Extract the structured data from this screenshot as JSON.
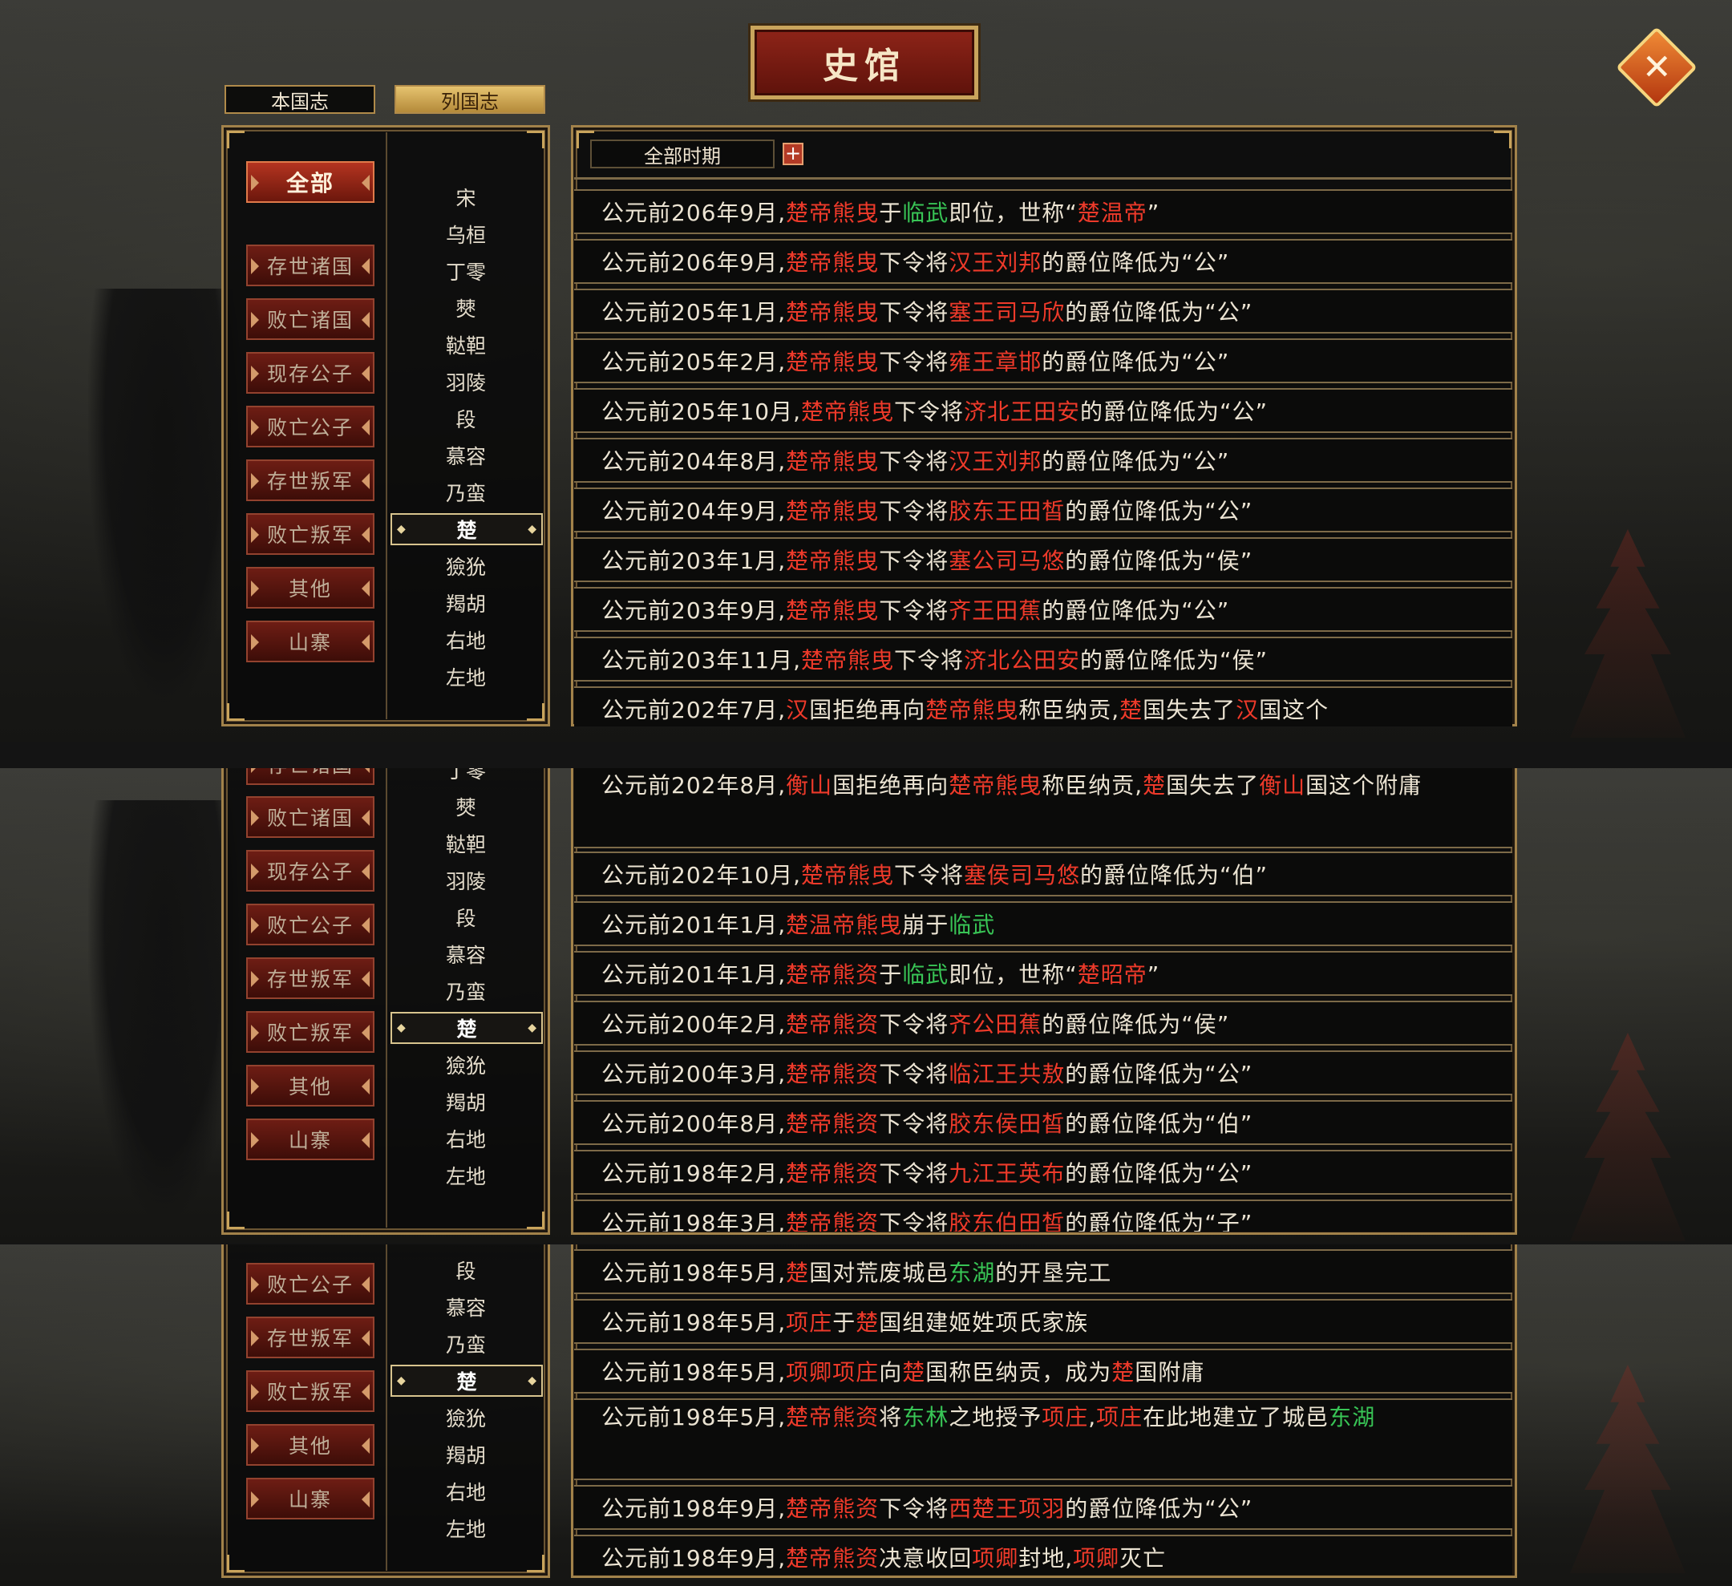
{
  "title": "史馆",
  "close_label": "✕",
  "tabs": [
    "本国志",
    "列国志"
  ],
  "period_select": "全部时期",
  "plus_label": "+",
  "categories": [
    "全部",
    "存世诸国",
    "败亡诸国",
    "现存公子",
    "败亡公子",
    "存世叛军",
    "败亡叛军",
    "其他",
    "山寨"
  ],
  "nations": [
    "宋",
    "乌桓",
    "丁零",
    "僰",
    "鞑靼",
    "羽陵",
    "段",
    "慕容",
    "乃蛮",
    "楚",
    "獫狁",
    "羯胡",
    "右地",
    "左地"
  ],
  "selected_nation": "楚",
  "events": [
    [
      [
        "公元前206年9月,",
        ""
      ],
      [
        "楚帝熊曳",
        "r"
      ],
      [
        "于",
        ""
      ],
      [
        "临武",
        "g"
      ],
      [
        "即位，世称“",
        ""
      ],
      [
        "楚温帝",
        "r"
      ],
      [
        "”",
        ""
      ]
    ],
    [
      [
        "公元前206年9月,",
        ""
      ],
      [
        "楚帝熊曳",
        "r"
      ],
      [
        "下令将",
        ""
      ],
      [
        "汉王刘邦",
        "r"
      ],
      [
        "的爵位降低为“公”",
        ""
      ]
    ],
    [
      [
        "公元前205年1月,",
        ""
      ],
      [
        "楚帝熊曳",
        "r"
      ],
      [
        "下令将",
        ""
      ],
      [
        "塞王司马欣",
        "r"
      ],
      [
        "的爵位降低为“公”",
        ""
      ]
    ],
    [
      [
        "公元前205年2月,",
        ""
      ],
      [
        "楚帝熊曳",
        "r"
      ],
      [
        "下令将",
        ""
      ],
      [
        "雍王章邯",
        "r"
      ],
      [
        "的爵位降低为“公”",
        ""
      ]
    ],
    [
      [
        "公元前205年10月,",
        ""
      ],
      [
        "楚帝熊曳",
        "r"
      ],
      [
        "下令将",
        ""
      ],
      [
        "济北王田安",
        "r"
      ],
      [
        "的爵位降低为“公”",
        ""
      ]
    ],
    [
      [
        "公元前204年8月,",
        ""
      ],
      [
        "楚帝熊曳",
        "r"
      ],
      [
        "下令将",
        ""
      ],
      [
        "汉王刘邦",
        "r"
      ],
      [
        "的爵位降低为“公”",
        ""
      ]
    ],
    [
      [
        "公元前204年9月,",
        ""
      ],
      [
        "楚帝熊曳",
        "r"
      ],
      [
        "下令将",
        ""
      ],
      [
        "胶东王田皙",
        "r"
      ],
      [
        "的爵位降低为“公”",
        ""
      ]
    ],
    [
      [
        "公元前203年1月,",
        ""
      ],
      [
        "楚帝熊曳",
        "r"
      ],
      [
        "下令将",
        ""
      ],
      [
        "塞公司马悠",
        "r"
      ],
      [
        "的爵位降低为“侯”",
        ""
      ]
    ],
    [
      [
        "公元前203年9月,",
        ""
      ],
      [
        "楚帝熊曳",
        "r"
      ],
      [
        "下令将",
        ""
      ],
      [
        "齐王田蕉",
        "r"
      ],
      [
        "的爵位降低为“公”",
        ""
      ]
    ],
    [
      [
        "公元前203年11月,",
        ""
      ],
      [
        "楚帝熊曳",
        "r"
      ],
      [
        "下令将",
        ""
      ],
      [
        "济北公田安",
        "r"
      ],
      [
        "的爵位降低为“侯”",
        ""
      ]
    ],
    [
      [
        "公元前202年7月,",
        ""
      ],
      [
        "汉",
        "r"
      ],
      [
        "国拒绝再向",
        ""
      ],
      [
        "楚帝熊曳",
        "r"
      ],
      [
        "称臣纳贡,",
        ""
      ],
      [
        "楚",
        "r"
      ],
      [
        "国失去了",
        ""
      ],
      [
        "汉",
        "r"
      ],
      [
        "国这个",
        ""
      ]
    ],
    [
      [
        "公元前202年8月,",
        ""
      ],
      [
        "衡山",
        "r"
      ],
      [
        "国拒绝再向",
        ""
      ],
      [
        "楚帝熊曳",
        "r"
      ],
      [
        "称臣纳贡,",
        ""
      ],
      [
        "楚",
        "r"
      ],
      [
        "国失去了",
        ""
      ],
      [
        "衡山",
        "r"
      ],
      [
        "国这个附庸",
        ""
      ]
    ],
    [
      [
        "公元前202年10月,",
        ""
      ],
      [
        "楚帝熊曳",
        "r"
      ],
      [
        "下令将",
        ""
      ],
      [
        "塞侯司马悠",
        "r"
      ],
      [
        "的爵位降低为“伯”",
        ""
      ]
    ],
    [
      [
        "公元前201年1月,",
        ""
      ],
      [
        "楚温帝熊曳",
        "r"
      ],
      [
        "崩于",
        ""
      ],
      [
        "临武",
        "g"
      ]
    ],
    [
      [
        "公元前201年1月,",
        ""
      ],
      [
        "楚帝熊资",
        "r"
      ],
      [
        "于",
        ""
      ],
      [
        "临武",
        "g"
      ],
      [
        "即位，世称“",
        ""
      ],
      [
        "楚昭帝",
        "r"
      ],
      [
        "”",
        ""
      ]
    ],
    [
      [
        "公元前200年2月,",
        ""
      ],
      [
        "楚帝熊资",
        "r"
      ],
      [
        "下令将",
        ""
      ],
      [
        "齐公田蕉",
        "r"
      ],
      [
        "的爵位降低为“侯”",
        ""
      ]
    ],
    [
      [
        "公元前200年3月,",
        ""
      ],
      [
        "楚帝熊资",
        "r"
      ],
      [
        "下令将",
        ""
      ],
      [
        "临江王共敖",
        "r"
      ],
      [
        "的爵位降低为“公”",
        ""
      ]
    ],
    [
      [
        "公元前200年8月,",
        ""
      ],
      [
        "楚帝熊资",
        "r"
      ],
      [
        "下令将",
        ""
      ],
      [
        "胶东侯田皙",
        "r"
      ],
      [
        "的爵位降低为“伯”",
        ""
      ]
    ],
    [
      [
        "公元前198年2月,",
        ""
      ],
      [
        "楚帝熊资",
        "r"
      ],
      [
        "下令将",
        ""
      ],
      [
        "九江王英布",
        "r"
      ],
      [
        "的爵位降低为“公”",
        ""
      ]
    ],
    [
      [
        "公元前198年3月,",
        ""
      ],
      [
        "楚帝熊资",
        "r"
      ],
      [
        "下令将",
        ""
      ],
      [
        "胶东伯田皙",
        "r"
      ],
      [
        "的爵位降低为“子”",
        ""
      ]
    ],
    [
      [
        "公元前198年5月,",
        ""
      ],
      [
        "楚",
        "r"
      ],
      [
        "国对荒废城邑",
        ""
      ],
      [
        "东湖",
        "g"
      ],
      [
        "的开垦完工",
        ""
      ]
    ],
    [
      [
        "公元前198年5月,",
        ""
      ],
      [
        "项庄",
        "r"
      ],
      [
        "于",
        ""
      ],
      [
        "楚",
        "r"
      ],
      [
        "国组建姬姓项氏家族",
        ""
      ]
    ],
    [
      [
        "公元前198年5月,",
        ""
      ],
      [
        "项卿项庄",
        "r"
      ],
      [
        "向",
        ""
      ],
      [
        "楚",
        "r"
      ],
      [
        "国称臣纳贡，成为",
        ""
      ],
      [
        "楚",
        "r"
      ],
      [
        "国附庸",
        ""
      ]
    ],
    [
      [
        "公元前198年5月,",
        ""
      ],
      [
        "楚帝熊资",
        "r"
      ],
      [
        "将",
        ""
      ],
      [
        "东林",
        "g"
      ],
      [
        "之地授予",
        ""
      ],
      [
        "项庄",
        "r"
      ],
      [
        ",",
        ""
      ],
      [
        "项庄",
        "r"
      ],
      [
        "在此地建立了城邑",
        ""
      ],
      [
        "东湖",
        "g"
      ]
    ],
    [
      [
        "公元前198年9月,",
        ""
      ],
      [
        "楚帝熊资",
        "r"
      ],
      [
        "下令将",
        ""
      ],
      [
        "西楚王项羽",
        "r"
      ],
      [
        "的爵位降低为“公”",
        ""
      ]
    ],
    [
      [
        "公元前198年9月,",
        ""
      ],
      [
        "楚帝熊资",
        "r"
      ],
      [
        "决意收回",
        ""
      ],
      [
        "项卿",
        "r"
      ],
      [
        "封地,",
        ""
      ],
      [
        "项卿",
        "r"
      ],
      [
        "灭亡",
        ""
      ]
    ]
  ]
}
